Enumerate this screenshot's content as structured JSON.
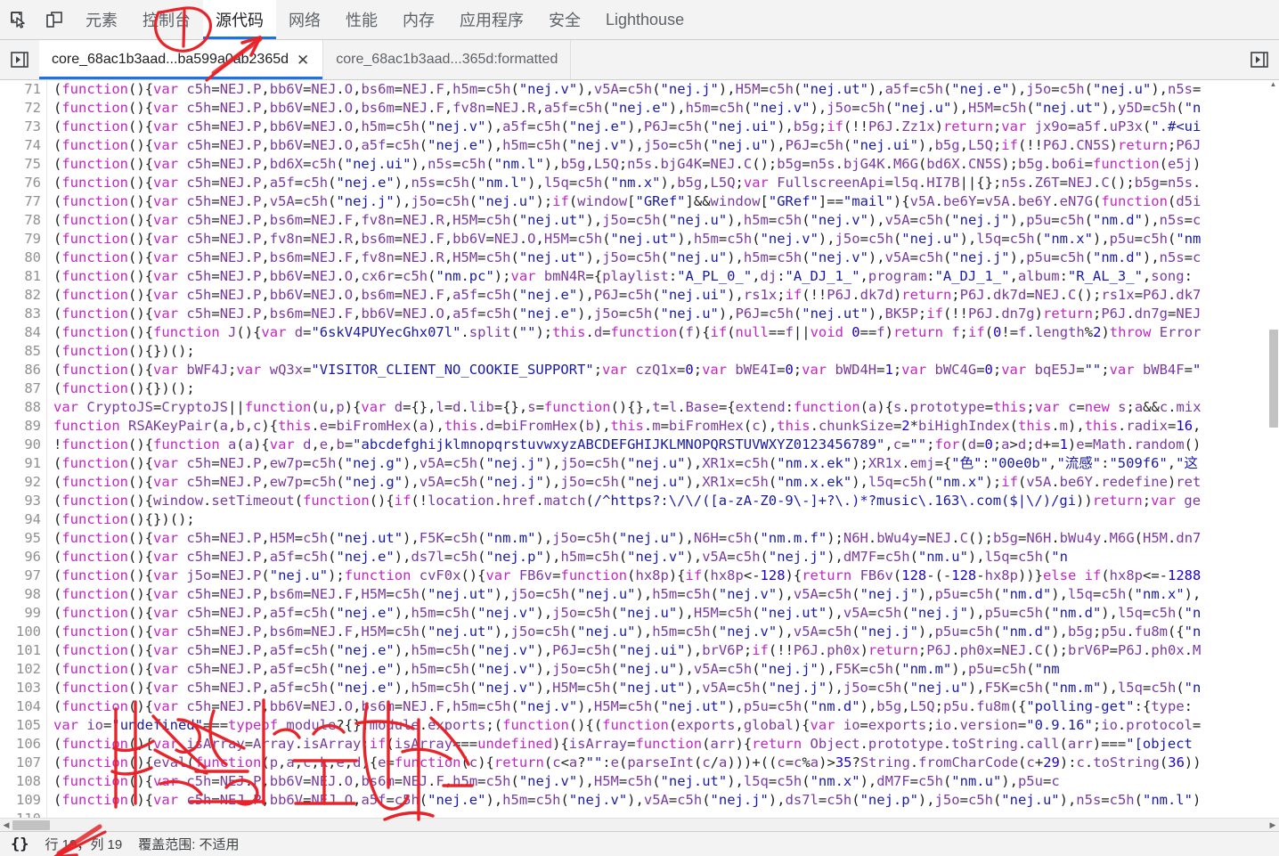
{
  "toolbar": {
    "icons": [
      {
        "name": "inspect-element-icon",
        "label": "检查元素"
      },
      {
        "name": "device-toolbar-icon",
        "label": "切换设备工具栏"
      }
    ],
    "tabs": [
      {
        "label": "元素",
        "selected": false
      },
      {
        "label": "控制台",
        "selected": false
      },
      {
        "label": "源代码",
        "selected": true
      },
      {
        "label": "网络",
        "selected": false
      },
      {
        "label": "性能",
        "selected": false
      },
      {
        "label": "内存",
        "selected": false
      },
      {
        "label": "应用程序",
        "selected": false
      },
      {
        "label": "安全",
        "selected": false
      },
      {
        "label": "Lighthouse",
        "selected": false
      }
    ]
  },
  "file_tabstrip": {
    "left_button": "show-navigator-icon",
    "right_button": "show-debugger-icon",
    "tabs": [
      {
        "label": "core_68ac1b3aad...ba599a0ab2365d",
        "selected": true,
        "close": "✕"
      },
      {
        "label": "core_68ac1b3aad...365d:formatted",
        "selected": false,
        "close": ""
      }
    ]
  },
  "statusbar": {
    "pretty_print": "{}",
    "cursor": "行 19，列 19",
    "coverage": "覆盖范围: 不适用"
  },
  "scrollbars": {
    "h_left_arrow": "◀",
    "h_right_arrow": "▶",
    "v_up_arrow": "▲",
    "v_down_arrow": "▼"
  },
  "annotations": {
    "circle_target": "控制台",
    "arrow_target": "源代码",
    "handwriting": "红色手写批注",
    "color": "#e8242a"
  },
  "editor": {
    "first_line": 71,
    "lines": [
      {
        "n": 71,
        "t": "(function(){var c5h=NEJ.P,bb6V=NEJ.O,bs6m=NEJ.F,h5m=c5h(\"nej.v\"),v5A=c5h(\"nej.j\"),H5M=c5h(\"nej.ut\"),a5f=c5h(\"nej.e\"),j5o=c5h(\"nej.u\"),n5s="
      },
      {
        "n": 72,
        "t": "(function(){var c5h=NEJ.P,bb6V=NEJ.O,bs6m=NEJ.F,fv8n=NEJ.R,a5f=c5h(\"nej.e\"),h5m=c5h(\"nej.v\"),j5o=c5h(\"nej.u\"),H5M=c5h(\"nej.ut\"),y5D=c5h(\"n"
      },
      {
        "n": 73,
        "t": "(function(){var c5h=NEJ.P,bb6V=NEJ.O,h5m=c5h(\"nej.v\"),a5f=c5h(\"nej.e\"),P6J=c5h(\"nej.ui\"),b5g;if(!!P6J.Zz1x)return;var jx9o=a5f.uP3x(\".#<ui"
      },
      {
        "n": 74,
        "t": "(function(){var c5h=NEJ.P,bb6V=NEJ.O,a5f=c5h(\"nej.e\"),h5m=c5h(\"nej.v\"),j5o=c5h(\"nej.u\"),P6J=c5h(\"nej.ui\"),b5g,L5Q;if(!!P6J.CN5S)return;P6J"
      },
      {
        "n": 75,
        "t": "(function(){var c5h=NEJ.P,bd6X=c5h(\"nej.ui\"),n5s=c5h(\"nm.l\"),b5g,L5Q;n5s.bjG4K=NEJ.C();b5g=n5s.bjG4K.M6G(bd6X.CN5S);b5g.bo6i=function(e5j)"
      },
      {
        "n": 76,
        "t": "(function(){var c5h=NEJ.P,a5f=c5h(\"nej.e\"),n5s=c5h(\"nm.l\"),l5q=c5h(\"nm.x\"),b5g,L5Q;var FullscreenApi=l5q.HI7B||{};n5s.Z6T=NEJ.C();b5g=n5s."
      },
      {
        "n": 77,
        "t": "(function(){var c5h=NEJ.P,v5A=c5h(\"nej.j\"),j5o=c5h(\"nej.u\");if(window[\"GRef\"]&&window[\"GRef\"]==\"mail\"){v5A.be6Y=v5A.be6Y.eN7G(function(d5i"
      },
      {
        "n": 78,
        "t": "(function(){var c5h=NEJ.P,bs6m=NEJ.F,fv8n=NEJ.R,H5M=c5h(\"nej.ut\"),j5o=c5h(\"nej.u\"),h5m=c5h(\"nej.v\"),v5A=c5h(\"nej.j\"),p5u=c5h(\"nm.d\"),n5s=c"
      },
      {
        "n": 79,
        "t": "(function(){var c5h=NEJ.P,fv8n=NEJ.R,bs6m=NEJ.F,bb6V=NEJ.O,H5M=c5h(\"nej.ut\"),h5m=c5h(\"nej.v\"),j5o=c5h(\"nej.u\"),l5q=c5h(\"nm.x\"),p5u=c5h(\"nm"
      },
      {
        "n": 80,
        "t": "(function(){var c5h=NEJ.P,bs6m=NEJ.F,fv8n=NEJ.R,H5M=c5h(\"nej.ut\"),j5o=c5h(\"nej.u\"),h5m=c5h(\"nej.v\"),v5A=c5h(\"nej.j\"),p5u=c5h(\"nm.d\"),n5s=c"
      },
      {
        "n": 81,
        "t": "(function(){var c5h=NEJ.P,bb6V=NEJ.O,cx6r=c5h(\"nm.pc\");var bmN4R={playlist:\"A_PL_0_\",dj:\"A_DJ_1_\",program:\"A_DJ_1_\",album:\"R_AL_3_\",song:"
      },
      {
        "n": 82,
        "t": "(function(){var c5h=NEJ.P,bb6V=NEJ.O,bs6m=NEJ.F,a5f=c5h(\"nej.e\"),P6J=c5h(\"nej.ui\"),rs1x;if(!!P6J.dk7d)return;P6J.dk7d=NEJ.C();rs1x=P6J.dk7"
      },
      {
        "n": 83,
        "t": "(function(){var c5h=NEJ.P,bs6m=NEJ.F,bb6V=NEJ.O,a5f=c5h(\"nej.e\"),j5o=c5h(\"nej.u\"),P6J=c5h(\"nej.ut\"),BK5P;if(!!P6J.dn7g)return;P6J.dn7g=NEJ"
      },
      {
        "n": 84,
        "t": "(function(){function J(){var d=\"6skV4PUYecGhx07l\".split(\"\");this.d=function(f){if(null==f||void 0==f)return f;if(0!=f.length%2)throw Error"
      },
      {
        "n": 85,
        "t": "(function(){})();"
      },
      {
        "n": 86,
        "t": "(function(){var bWF4J;var wQ3x=\"VISITOR_CLIENT_NO_COOKIE_SUPPORT\";var czQ1x=0;var bWE4I=0;var bWD4H=1;var bWC4G=0;var bqE5J=\"\";var bWB4F=\""
      },
      {
        "n": 87,
        "t": "(function(){})();"
      },
      {
        "n": 88,
        "t": "var CryptoJS=CryptoJS||function(u,p){var d={},l=d.lib={},s=function(){},t=l.Base={extend:function(a){s.prototype=this;var c=new s;a&&c.mix"
      },
      {
        "n": 89,
        "t": "function RSAKeyPair(a,b,c){this.e=biFromHex(a),this.d=biFromHex(b),this.m=biFromHex(c),this.chunkSize=2*biHighIndex(this.m),this.radix=16,"
      },
      {
        "n": 90,
        "t": "!function(){function a(a){var d,e,b=\"abcdefghijklmnopqrstuvwxyzABCDEFGHIJKLMNOPQRSTUVWXYZ0123456789\",c=\"\";for(d=0;a>d;d+=1)e=Math.random()"
      },
      {
        "n": 91,
        "t": "(function(){var c5h=NEJ.P,ew7p=c5h(\"nej.g\"),v5A=c5h(\"nej.j\"),j5o=c5h(\"nej.u\"),XR1x=c5h(\"nm.x.ek\");XR1x.emj={\"色\":\"00e0b\",\"流感\":\"509f6\",\"这"
      },
      {
        "n": 92,
        "t": "(function(){var c5h=NEJ.P,ew7p=c5h(\"nej.g\"),v5A=c5h(\"nej.j\"),j5o=c5h(\"nej.u\"),XR1x=c5h(\"nm.x.ek\"),l5q=c5h(\"nm.x\");if(v5A.be6Y.redefine)ret"
      },
      {
        "n": 93,
        "t": "(function(){window.setTimeout(function(){if(!location.href.match(/^https?:\\/\\/([a-zA-Z0-9\\-]+?\\.)*?music\\.163\\.com($|\\/)/gi))return;var ge"
      },
      {
        "n": 94,
        "t": "(function(){})();"
      },
      {
        "n": 95,
        "t": "(function(){var c5h=NEJ.P,H5M=c5h(\"nej.ut\"),F5K=c5h(\"nm.m\"),j5o=c5h(\"nej.u\"),N6H=c5h(\"nm.m.f\");N6H.bWu4y=NEJ.C();b5g=N6H.bWu4y.M6G(H5M.dn7"
      },
      {
        "n": 96,
        "t": "(function(){var c5h=NEJ.P,a5f=c5h(\"nej.e\"),ds7l=c5h(\"nej.p\"),h5m=c5h(\"nej.v\"),v5A=c5h(\"nej.j\"),dM7F=c5h(\"nm.u\"),l5q=c5h(\"n"
      },
      {
        "n": 97,
        "t": "(function(){var j5o=NEJ.P(\"nej.u\");function cvF0x(){var FB6v=function(hx8p){if(hx8p<-128){return FB6v(128-(-128-hx8p))}else if(hx8p<=-1288"
      },
      {
        "n": 98,
        "t": "(function(){var c5h=NEJ.P,bs6m=NEJ.F,H5M=c5h(\"nej.ut\"),j5o=c5h(\"nej.u\"),h5m=c5h(\"nej.v\"),v5A=c5h(\"nej.j\"),p5u=c5h(\"nm.d\"),l5q=c5h(\"nm.x\"),"
      },
      {
        "n": 99,
        "t": "(function(){var c5h=NEJ.P,a5f=c5h(\"nej.e\"),h5m=c5h(\"nej.v\"),j5o=c5h(\"nej.u\"),H5M=c5h(\"nej.ut\"),v5A=c5h(\"nej.j\"),p5u=c5h(\"nm.d\"),l5q=c5h(\"n"
      },
      {
        "n": 100,
        "t": "(function(){var c5h=NEJ.P,bs6m=NEJ.F,H5M=c5h(\"nej.ut\"),j5o=c5h(\"nej.u\"),h5m=c5h(\"nej.v\"),v5A=c5h(\"nej.j\"),p5u=c5h(\"nm.d\"),b5g;p5u.fu8m({\"n"
      },
      {
        "n": 101,
        "t": "(function(){var c5h=NEJ.P,a5f=c5h(\"nej.e\"),h5m=c5h(\"nej.v\"),P6J=c5h(\"nej.ui\"),brV6P;if(!!P6J.ph0x)return;P6J.ph0x=NEJ.C();brV6P=P6J.ph0x.M"
      },
      {
        "n": 102,
        "t": "(function(){var c5h=NEJ.P,a5f=c5h(\"nej.e\"),h5m=c5h(\"nej.v\"),j5o=c5h(\"nej.u\"),v5A=c5h(\"nej.j\"),F5K=c5h(\"nm.m\"),p5u=c5h(\"nm"
      },
      {
        "n": 103,
        "t": "(function(){var c5h=NEJ.P,a5f=c5h(\"nej.e\"),h5m=c5h(\"nej.v\"),H5M=c5h(\"nej.ut\"),v5A=c5h(\"nej.j\"),j5o=c5h(\"nej.u\"),F5K=c5h(\"nm.m\"),l5q=c5h(\"n"
      },
      {
        "n": 104,
        "t": "(function(){var c5h=NEJ.P,bb6V=NEJ.O,bs6m=NEJ.F,h5m=c5h(\"nej.v\"),H5M=c5h(\"nej.ut\"),p5u=c5h(\"nm.d\"),b5g,L5Q;p5u.fu8m({\"polling-get\":{type:"
      },
      {
        "n": 105,
        "t": "var io=\"undefined\"===typeof module?{}:module.exports;(function(){(function(exports,global){var io=exports;io.version=\"0.9.16\";io.protocol="
      },
      {
        "n": 106,
        "t": "(function(){var isArray=Array.isArray;if(isArray===undefined){isArray=function(arr){return Object.prototype.toString.call(arr)===\"[object"
      },
      {
        "n": 107,
        "t": "(function(){eval(function(p,a,c,k,e,d){e=function(c){return(c<a?\"\":e(parseInt(c/a)))+((c=c%a)>35?String.fromCharCode(c+29):c.toString(36))"
      },
      {
        "n": 108,
        "t": "(function(){var c5h=NEJ.P,bb6V=NEJ.O,bs6m=NEJ.F,h5m=c5h(\"nej.v\"),H5M=c5h(\"nej.ut\"),l5q=c5h(\"nm.x\"),dM7F=c5h(\"nm.u\"),p5u=c"
      },
      {
        "n": 109,
        "t": "(function(){var c5h=NEJ.P,bb6V=NEJ.O,a5f=c5h(\"nej.e\"),h5m=c5h(\"nej.v\"),v5A=c5h(\"nej.j\"),ds7l=c5h(\"nej.p\"),j5o=c5h(\"nej.u\"),n5s=c5h(\"nm.l\")"
      },
      {
        "n": 110,
        "t": ""
      }
    ]
  }
}
